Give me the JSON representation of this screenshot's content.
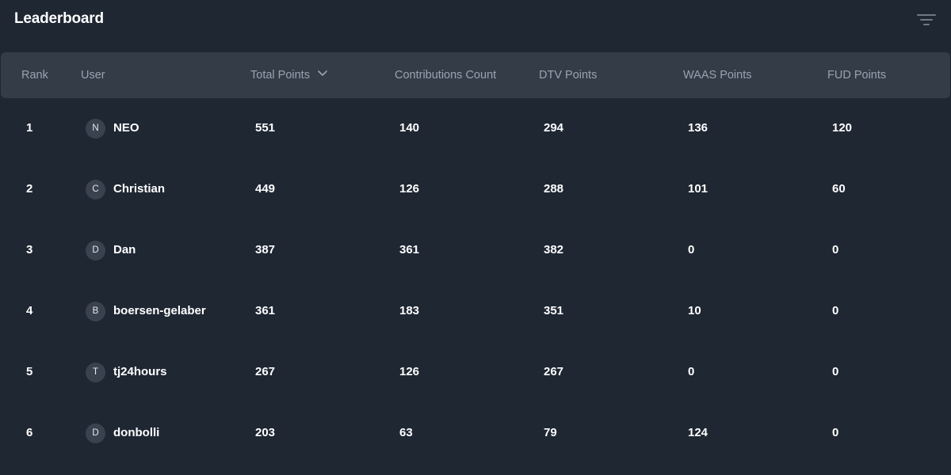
{
  "header": {
    "title": "Leaderboard",
    "filter_icon": "filter-icon"
  },
  "columns": [
    {
      "key": "rank",
      "label": "Rank"
    },
    {
      "key": "user",
      "label": "User"
    },
    {
      "key": "total",
      "label": "Total Points",
      "sorted": "desc"
    },
    {
      "key": "contributions",
      "label": "Contributions Count"
    },
    {
      "key": "dtv",
      "label": "DTV Points"
    },
    {
      "key": "waas",
      "label": "WAAS Points"
    },
    {
      "key": "fud",
      "label": "FUD Points"
    }
  ],
  "rows": [
    {
      "rank": "1",
      "initial": "N",
      "user": "NEO",
      "total": "551",
      "contributions": "140",
      "dtv": "294",
      "waas": "136",
      "fud": "120"
    },
    {
      "rank": "2",
      "initial": "C",
      "user": "Christian",
      "total": "449",
      "contributions": "126",
      "dtv": "288",
      "waas": "101",
      "fud": "60"
    },
    {
      "rank": "3",
      "initial": "D",
      "user": "Dan",
      "total": "387",
      "contributions": "361",
      "dtv": "382",
      "waas": "0",
      "fud": "0"
    },
    {
      "rank": "4",
      "initial": "B",
      "user": "boersen-gelaber",
      "total": "361",
      "contributions": "183",
      "dtv": "351",
      "waas": "10",
      "fud": "0"
    },
    {
      "rank": "5",
      "initial": "T",
      "user": "tj24hours",
      "total": "267",
      "contributions": "126",
      "dtv": "267",
      "waas": "0",
      "fud": "0"
    },
    {
      "rank": "6",
      "initial": "D",
      "user": "donbolli",
      "total": "203",
      "contributions": "63",
      "dtv": "79",
      "waas": "124",
      "fud": "0"
    }
  ],
  "colors": {
    "background": "#1f2733",
    "header_bg": "#343c48",
    "header_text": "#9aa3b0",
    "avatar_bg": "#3a4250"
  }
}
